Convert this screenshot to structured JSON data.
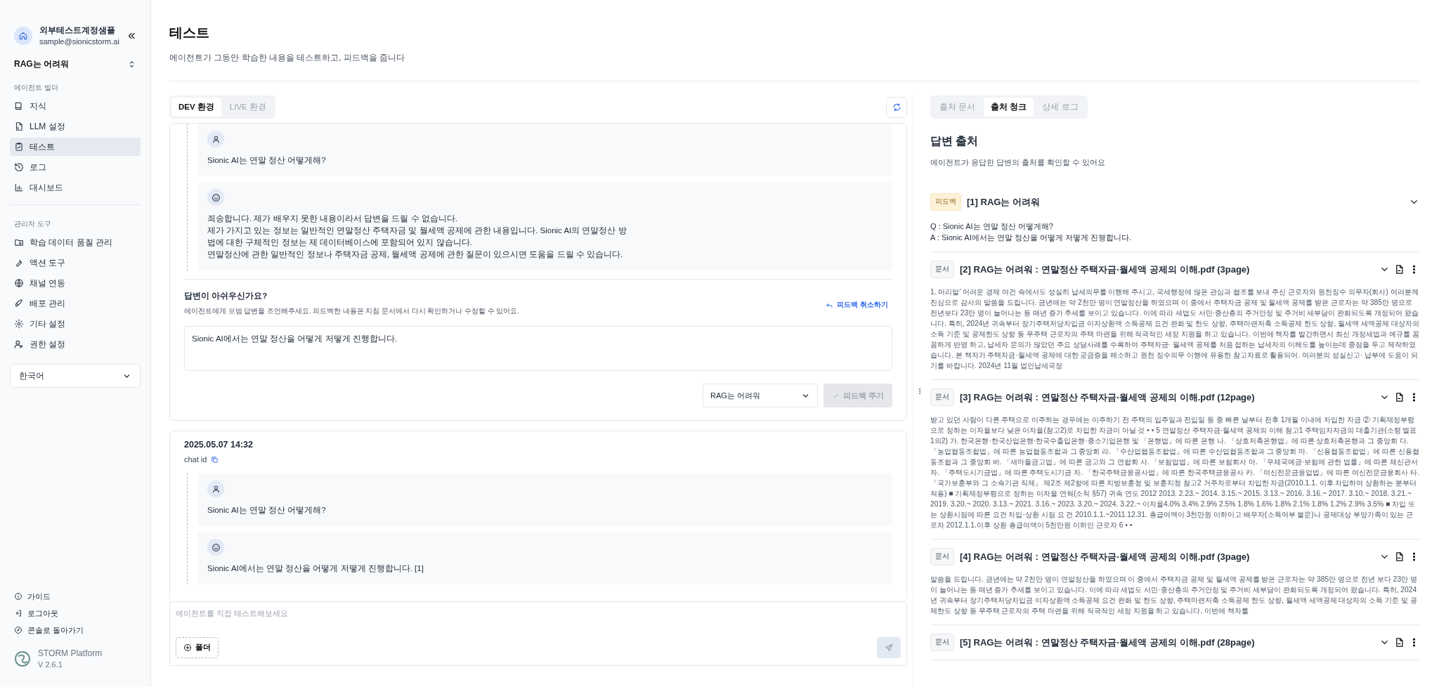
{
  "sidebar": {
    "workspace": {
      "name": "외부테스트계정샘플",
      "email": "sample@sionicstorm.ai"
    },
    "project": "RAG는 어려워",
    "sections": [
      {
        "title": "에이전트 빌더",
        "items": [
          {
            "label": "지식",
            "selected": false
          },
          {
            "label": "LLM 설정",
            "selected": false
          },
          {
            "label": "테스트",
            "selected": true
          },
          {
            "label": "로그",
            "selected": false
          },
          {
            "label": "대시보드",
            "selected": false
          }
        ]
      },
      {
        "title": "관리자 도구",
        "items": [
          {
            "label": "학습 데이터 품질 관리",
            "selected": false
          },
          {
            "label": "액션 도구",
            "selected": false
          },
          {
            "label": "채널 연동",
            "selected": false
          },
          {
            "label": "배포 관리",
            "selected": false
          },
          {
            "label": "기타 설정",
            "selected": false
          },
          {
            "label": "권한 설정",
            "selected": false
          }
        ]
      }
    ],
    "language": "한국어",
    "footer_links": [
      "가이드",
      "로그아웃",
      "콘솔로 돌아가기"
    ],
    "brand": {
      "name": "STORM Platform",
      "version": "V 2.6.1"
    }
  },
  "page": {
    "title": "테스트",
    "description": "에이전트가 그동안 학습한 내용을 테스트하고, 피드백을 줍니다"
  },
  "chat": {
    "tabs": [
      {
        "label": "DEV 환경",
        "selected": true
      },
      {
        "label": "LIVE 환경",
        "selected": false
      }
    ],
    "conversations": [
      {
        "messages": [
          {
            "kind": "user",
            "text": "Sionic AI는 연말 정산 어떻게해?"
          },
          {
            "kind": "assistant",
            "text": "죄송합니다. 제가 배우지 못한 내용이라서 답변을 드릴 수 없습니다.\n제가 가지고 있는 정보는 일반적인 연말정산 주택자금 및 월세액 공제에 관한 내용입니다. Sionic AI의 연말정산 방\n법에 대한 구체적인 정보는 제 데이터베이스에 포함되어 있지 않습니다.\n연말정산에 관한 일반적인 정보나 주택자금 공제, 월세액 공제에 관한 질문이 있으시면 도움을 드릴 수 있습니다."
          }
        ],
        "feedback": {
          "title": "답변이 아쉬우신가요?",
          "description": "에이전트에게 모범 답변을 조언해주세요. 피드백한 내용은 지침 문서에서 다시 확인하거나 수정할 수 있어요.",
          "undo_link": "피드백 취소하기",
          "answer": "Sionic AI에서는 연말 정산을 어떻게 저떻게 진행합니다.",
          "select": "RAG는 어려워",
          "submit": {
            "label": "피드백 주기",
            "disabled": true
          }
        }
      },
      {
        "date": "2025.05.07 14:32",
        "chat_id_label": "chat id",
        "messages": [
          {
            "kind": "user",
            "text": "Sionic AI는 연말 정산 어떻게해?"
          },
          {
            "kind": "assistant",
            "text": "Sionic AI에서는 연말 정산을 어떻게 저떻게 진행합니다. [1]"
          }
        ]
      }
    ],
    "input": {
      "placeholder": "에이전트를 직접 테스트해보세요",
      "folder_button": "폴더"
    }
  },
  "sources": {
    "tabs": [
      {
        "label": "출처 문서",
        "selected": false
      },
      {
        "label": "출처 청크",
        "selected": true
      },
      {
        "label": "상세 로그",
        "selected": false
      }
    ],
    "title": "답변 출처",
    "description": "에이전트가 응답한 답변의 출처를 확인할 수 있어요",
    "items": [
      {
        "kind": "feedback",
        "tag": "피드백",
        "title": "[1] RAG는 어려워",
        "lines": [
          "Q : Sionic AI는 연말 정산 어떻게해?",
          "A : Sionic AI에서는 연말 정산을 어떻게 저떻게 진행합니다."
        ]
      },
      {
        "kind": "document",
        "tag": "문서",
        "title": "[2] RAG는 어려워 : 연말정산 주택자금·월세액 공제의 이해.pdf (3page)",
        "body": "1. 머리말’ 어려운 경제 여건 속에서도 성실히 납세의무를 이행해 주시고, 국세행정에 많은 관심과 협조를 보내 주신 근로자와 원천징수 의무자(회사) 여러분께 진심으로 감사의 말씀을 드립니다. 금년에는 약 2천만 명이 연말정산을 하였으며 이 중에서 주택자금 공제 및 월세액 공제를 받은 근로자는 약 385만 명으로 전년보다 23만 명이 늘어나는 등 매년 증가 추세를 보이고 있습니다. 이에 따라 세법도 서민·중산층의 주거안정 및 주거비 세부담이 완화되도록 개정되어 왔습니다. 특히, 2024년 귀속부터 장기주택저당차입금 이자상환액 소득공제 요건 완화 및 한도 상향, 주택마련저축 소득공제 한도 상향, 월세액 세액공제 대상자의 소득 기준 및 공제한도 상향 등 무주택 근로자의 주택 마련을 위해 적극적인 세정 지원을 하고 있습니다. 이번에 책자를 발간하면서 최신 개정세법과 예규를 꼼꼼하게 반영 하고, 납세자 문의가 많았던 주요 상담사례를 수록하여 주택자금· 월세액 공제를 처음 접하는 납세자의 이해도를 높이는데 중점을 두고 제작하였습니다. 본 책자가 주택자금·월세액 공제에 대한 궁금증을 해소하고 원천 징수의무 이행에 유용한 참고자료로 활용되어. 여러분의 성실신고· 납부에 도움이 되기를 바랍니다. 2024년 11월 법인납세국장"
      },
      {
        "kind": "document",
        "tag": "문서",
        "title": "[3] RAG는 어려워 : 연말정산 주택자금·월세액 공제의 이해.pdf (12page)",
        "body": "받고 있던 사람이 다른 주택으로 이주하는 경우에는 이주하기 전 주택의 입주일과 전입일 등 중 빠른 날부터 전후 1개월 이내에 차입한 자금 ② 기획재정부령으로 정하는 이자율보다 낮은 이자율(참고2)로 차입한 자금이 아닐 것 • • 5 연말정산 주택자금·월세액 공제의 이해 참고1 주택임차자금의 대출기관(소령 별표1의2) 가. 한국은행·한국산업은행·한국수출입은행·중소기업은행 및 「은행법」에 따른 은행 나. 「상호저축은행법」에 따른 상호저축은행과 그 중앙회 다. 「농업협동조합법」에 따른 농업협동조합과 그 중앙회 라. 「수산업협동조합법」에 따른 수산업협동조합과 그 중앙회 마. 「신용협동조합법」에 따른 신용협동조합과 그 중앙회 바. 「새마을금고법」에 따른 금고와 그 연합회 사. 「보험업법」에 따른 보험회사 아. 「우체국예금·보험에 관한 법률」에 따른 체신관서 자. 「주택도시기금법」에 따른 주택도시기금 차. 「한국주택금융공사법」에 따른 한국주택금융공사 카. 「여신전문금융업법」에 따른 여신전문금융회사 타. 「국가보훈부와 그 소속기관 직제」 제2조 제2항에 따른 지방보훈청 및 보훈지청 참고2 거주자로부터 차입한 자금(2010.1.1. 이후 차입하여 상환하는 분부터 적용) ■ 기획재정부령으로 정하는 이자율 연혁(소칙 §57) 귀속 연도 2012 2013. 2.23.~ 2014. 3.15.~ 2015. 3.13.~ 2016. 3.16.~ 2017. 3.10.~ 2018. 3.21.~ 2019. 3.20.~ 2020. 3.13.~ 2021. 3.16.~ 2023. 3.20.~ 2024. 3.22.~ 이자율4.0% 3.4% 2.9% 2.5% 1.8% 1.6% 1.8% 2.1% 1.8% 1.2% 2.9% 3.5% ■ 차입 또는 상환시점에 따른 요건 차입·상환 시점 요 건 2010.1.1.~2011.12.31. 총급여액이 3천만원 이하이고 배우자(소득여부 불문)나 공제대상 부양가족이 있는 근로자 2012.1.1.이후 상환 총급여액이 5천만원 이하인 근로자 6 • •"
      },
      {
        "kind": "document",
        "tag": "문서",
        "title": "[4] RAG는 어려워 : 연말정산 주택자금·월세액 공제의 이해.pdf (3page)",
        "body": "말씀을 드립니다. 금년에는 약 2천만 명이 연말정산을 하였으며 이 중에서 주택자금 공제 및 월세액 공제를 받은 근로자는 약 385만 명으로 전년 보다 23만 명이 늘어나는 등 매년 증가 추세를 보이고 있습니다. 이에 따라 세법도 서민·중산층의 주거안정 및 주거비 세부담이 완화되도록 개정되어 왔습니다. 특히, 2024년 귀속부터 장기주택저당차입금 이자상환액 소득공제 요건 완화 및 한도 상향, 주택마련저축 소득공제 한도 상향, 월세액 세액공제 대상자의 소득 기준 및 공제한도 상향 등 무주택 근로자의 주택 마련을 위해 적극적인 세정 지원을 하고 있습니다. 이번에 책자를"
      },
      {
        "kind": "document",
        "tag": "문서",
        "title": "[5] RAG는 어려워 : 연말정산 주택자금·월세액 공제의 이해.pdf (28page)"
      }
    ]
  }
}
